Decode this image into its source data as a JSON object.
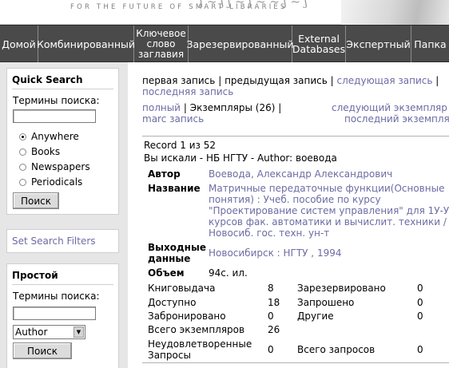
{
  "banner": {
    "tagline": "FOR THE FUTURE OF SMART LIBRARIES"
  },
  "nav": {
    "items": [
      "Домой",
      "Комбинированный",
      "Ключевое слово заглавия",
      "Зарезервированный",
      "External Databases",
      "Экспертный",
      "Папка"
    ]
  },
  "sidebar": {
    "quick_search": {
      "title": "Quick Search",
      "terms_label": "Термины поиска:",
      "terms_value": "",
      "options": [
        "Anywhere",
        "Books",
        "Newspapers",
        "Periodicals"
      ],
      "selected": "Anywhere",
      "search_button": "Поиск"
    },
    "set_filters_link": "Set Search Filters",
    "simple": {
      "title": "Простой",
      "terms_label": "Термины поиска:",
      "terms_value": "",
      "field_select": "Author",
      "search_button": "Поиск"
    }
  },
  "main": {
    "record_nav": {
      "first": "первая запись",
      "sep1": "|",
      "prev": "предыдущая запись",
      "sep2": "|",
      "next": "следующая запись",
      "sep3": "|",
      "last": "последняя запись"
    },
    "view_nav": {
      "full": "полный",
      "sep1": "|",
      "copies": "Экземпляры (26)",
      "sep2": "|",
      "marc": "marc запись",
      "next_copy": "следующий экземпляр",
      "sep3": "|",
      "last_copy": "последний экземпляр"
    },
    "record_count": "Record 1 из 52",
    "searched_for": "Вы искали - НБ НГТУ - Author: воевода",
    "fields": {
      "author_label": "Автор",
      "author_value": "Воевода, Александр Александрович",
      "title_label": "Название",
      "title_value_1": "Матричные передаточные функции(Основные",
      "title_value_2": "понятия) : Учеб. пособие по курсу",
      "title_value_3": "\"Проектирование систем управления\" для 1У-У",
      "title_value_4": "курсов фак. автоматики и вычислит. техники /",
      "title_value_5": "Новосиб. гос. техн. ун-т",
      "imprint_label_1": "Выходные",
      "imprint_label_2": "данные",
      "imprint_value": "Новосибирск : НГТУ , 1994",
      "extent_label": "Объем",
      "extent_value": "94с. ил."
    },
    "stats": {
      "loans_label": "Книговыдача",
      "loans_value": "8",
      "reserved_label": "Зарезервировано",
      "reserved_value": "0",
      "available_label": "Доступно",
      "available_value": "18",
      "requested_label": "Запрошено",
      "requested_value": "0",
      "booked_label": "Забронировано",
      "booked_value": "0",
      "other_label": "Другие",
      "other_value": "0",
      "total_copies_label": "Всего экземпляров",
      "total_copies_value": "26",
      "unfilled_label_1": "Неудовлетворенные",
      "unfilled_label_2": "Запросы",
      "unfilled_value": "0",
      "total_requests_label": "Всего запросов",
      "total_requests_value": "0"
    }
  }
}
